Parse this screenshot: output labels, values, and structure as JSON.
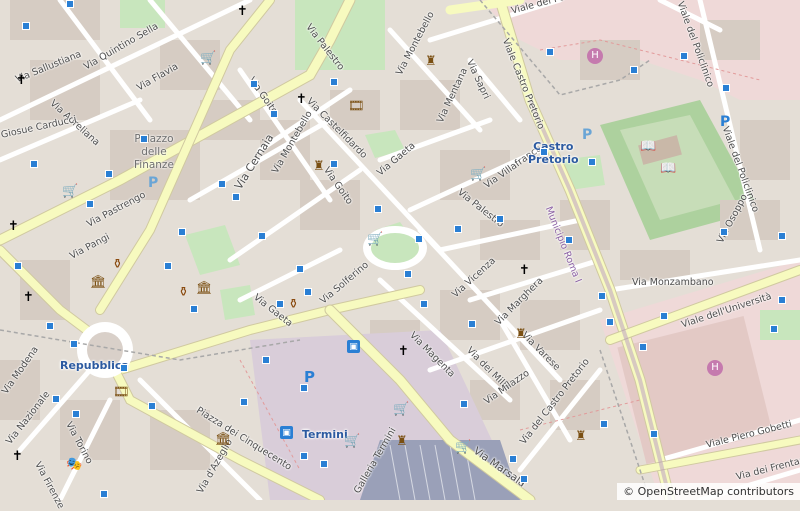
{
  "attribution": "© OpenStreetMap contributors",
  "streets": [
    {
      "id": "via-palestro-n",
      "text": "Via Palestro"
    },
    {
      "id": "via-palestro-s",
      "text": "Via Palestro"
    },
    {
      "id": "viale-castro-pretorio",
      "text": "Viale Castro Pretorio"
    },
    {
      "id": "via-montebello-n",
      "text": "Via Montebello"
    },
    {
      "id": "via-montebello-s",
      "text": "Via Montebello"
    },
    {
      "id": "via-mentana",
      "text": "Via Mentana"
    },
    {
      "id": "via-sapri",
      "text": "Via Sapri"
    },
    {
      "id": "via-castelfidardo",
      "text": "Via Castelfidardo"
    },
    {
      "id": "via-goito-w",
      "text": "Via Goito"
    },
    {
      "id": "via-goito-e",
      "text": "Via Goito"
    },
    {
      "id": "via-gaeta-n",
      "text": "Via Gaeta"
    },
    {
      "id": "via-gaeta-s",
      "text": "Via Gaeta"
    },
    {
      "id": "via-cernaia",
      "text": "Via Cernaia"
    },
    {
      "id": "via-villafranca",
      "text": "Via Villafranca"
    },
    {
      "id": "via-sallustiana",
      "text": "Via Sallustiana"
    },
    {
      "id": "via-quintino-sella",
      "text": "Via Quintino Sella"
    },
    {
      "id": "via-flavia",
      "text": "Via Flavia"
    },
    {
      "id": "via-aureliana",
      "text": "Via Aureliana"
    },
    {
      "id": "via-carducci",
      "text": "Giosue Carducci"
    },
    {
      "id": "via-pastrengo",
      "text": "Via Pastrengo"
    },
    {
      "id": "via-pangi",
      "text": "Via Pangi"
    },
    {
      "id": "via-solferino",
      "text": "Via Solferino"
    },
    {
      "id": "via-vicenza",
      "text": "Via Vicenza"
    },
    {
      "id": "via-magenta",
      "text": "Via Magenta"
    },
    {
      "id": "via-dei-mille",
      "text": "Via dei Mille"
    },
    {
      "id": "via-marghera",
      "text": "Via Marghera"
    },
    {
      "id": "via-varese",
      "text": "Via Varese"
    },
    {
      "id": "via-milazzo",
      "text": "Via Milazzo"
    },
    {
      "id": "via-del-castro-pretorio",
      "text": "Via del Castro Pretorio"
    },
    {
      "id": "via-monzambano",
      "text": "Via Monzambano"
    },
    {
      "id": "viale-universita",
      "text": "Viale dell'Università"
    },
    {
      "id": "via-osoppo",
      "text": "Via Osoppo"
    },
    {
      "id": "viale-policlinico-r",
      "text": "Viale del Policlinico"
    },
    {
      "id": "viale-policlinico-t",
      "text": "Viale del Policlinico"
    },
    {
      "id": "via-policlinico-top",
      "text": "Viale del Policlinico"
    },
    {
      "id": "via-marsala",
      "text": "Via Marsala"
    },
    {
      "id": "via-piero-gobetti",
      "text": "Viale Piero Gobetti"
    },
    {
      "id": "via-dei-frentani",
      "text": "Via dei Frentani"
    },
    {
      "id": "via-nazionale",
      "text": "Via Nazionale"
    },
    {
      "id": "via-torino",
      "text": "Via Torino"
    },
    {
      "id": "via-modena",
      "text": "Via Modena"
    },
    {
      "id": "via-firenze",
      "text": "Via Firenze"
    },
    {
      "id": "via-daaazeglio",
      "text": "Via d'Azeglio"
    },
    {
      "id": "piazza-cinquecento",
      "text": "Piazza dei Cinquecento"
    },
    {
      "id": "via-del-policlinico-top",
      "text": "Via del Policlinico"
    },
    {
      "id": "municipio",
      "text": "Municipio Roma I"
    },
    {
      "id": "galleria-termini",
      "text": "Galleria Termini"
    }
  ],
  "places": {
    "castro_pretorio": [
      "Castro",
      "Pretorio"
    ],
    "repubblica": "Repubblica",
    "termini": "Termini"
  },
  "buildings": {
    "palazzo_finanze": [
      "Palazzo",
      "delle",
      "Finanze"
    ]
  },
  "icons": [
    "church-icon",
    "bus-stop-icon",
    "parking-icon",
    "hospital-icon",
    "museum-icon",
    "shop-icon",
    "cinema-icon",
    "library-icon",
    "monument-icon",
    "theatre-icon"
  ],
  "colors": {
    "background": "#e4ded6",
    "block": "#d9d0c9",
    "building": "#d0c6bd",
    "road_major": "#f7fabf",
    "road_minor": "#ffffff",
    "park": "#c8e6bd",
    "green_campus": "#add19e",
    "hospital": "#f2dad9",
    "railway": "#a8a8a8",
    "water": "#aad3df",
    "stop": "#2a7fd4",
    "place_label": "#2c5aa0"
  }
}
